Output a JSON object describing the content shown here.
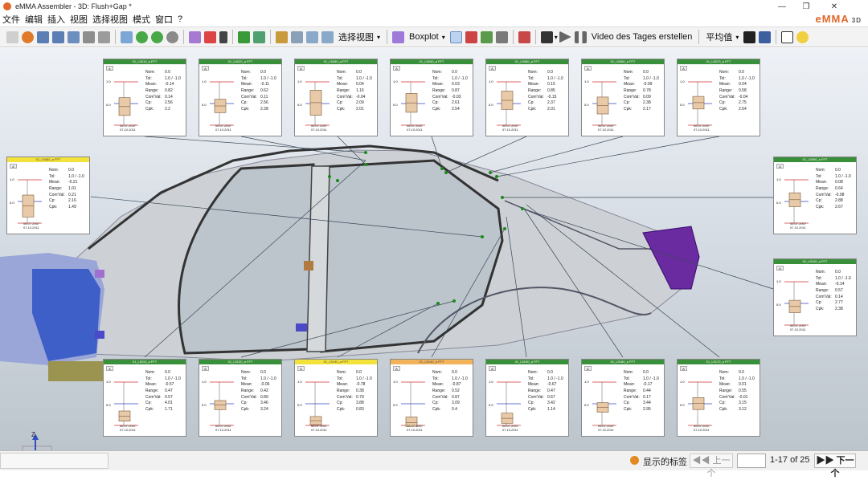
{
  "window": {
    "title": "eMMA Assembler - 3D: Flush+Gap *"
  },
  "menu": [
    "文件",
    "编辑",
    "插入",
    "视图",
    "选择视图",
    "模式",
    "窗口",
    "?"
  ],
  "brand": {
    "name": "eMMA",
    "suffix": "3D",
    "color": "#e1682a"
  },
  "toolbar": {
    "select_view": "选择视图",
    "boxplot": "Boxplot",
    "video": "Video des Tages erstellen",
    "average": "平均值"
  },
  "panel_labels": {
    "nom": "Nom:",
    "tol": "Tol:",
    "mean": "Mean:",
    "range": "Range:",
    "comval": "Com'Val:",
    "cp": "Cp:",
    "cpk": "Cpk:"
  },
  "panels": [
    {
      "header": "01_L5010_a FFT",
      "button": "A",
      "nom": "0.0",
      "tol": "1.0 / -1.0",
      "mean": "-0.14",
      "range": "0.82",
      "comval": "0.14",
      "cp": "2.56",
      "cpk": "2.2",
      "dates": [
        "06.07.2007",
        "07.10.2011"
      ],
      "style": "green",
      "axis": [
        "1.0",
        "0.0",
        "-1.0"
      ]
    },
    {
      "header": "01_L5020_a FFT",
      "button": "A",
      "nom": "0.0",
      "tol": "1.0 / -1.0",
      "mean": "-0.11",
      "range": "0.62",
      "comval": "0.11",
      "cp": "2.56",
      "cpk": "2.28",
      "dates": [
        "06.07.2007",
        "07.10.2011"
      ],
      "style": "green",
      "axis": [
        "1.0",
        "0.0",
        "-1.0"
      ]
    },
    {
      "header": "01_L5030_a FFT",
      "button": "A",
      "nom": "0.0",
      "tol": "1.0 / -1.0",
      "mean": "0.04",
      "range": "1.16",
      "comval": "-0.04",
      "cp": "2.09",
      "cpk": "2.01",
      "dates": [
        "06.07.2007",
        "07.10.2011"
      ],
      "style": "green",
      "axis": [
        "1.0",
        "0.0",
        "-1.0"
      ]
    },
    {
      "header": "01_L5040_a FFT",
      "button": "A",
      "nom": "0.0",
      "tol": "1.0 / -1.0",
      "mean": "0.03",
      "range": "0.87",
      "comval": "-0.03",
      "cp": "2.61",
      "cpk": "2.54",
      "dates": [
        "06.07.2007",
        "07.10.2011"
      ],
      "style": "green",
      "axis": [
        "1.0",
        "0.0",
        "-1.0"
      ]
    },
    {
      "header": "01_L5050_a FFT",
      "button": "A",
      "nom": "0.0",
      "tol": "1.0 / -1.0",
      "mean": "0.15",
      "range": "0.85",
      "comval": "-0.15",
      "cp": "2.37",
      "cpk": "2.01",
      "dates": [
        "06.07.2007",
        "07.10.2011"
      ],
      "style": "green",
      "axis": [
        "1.0",
        "0.0",
        "-1.0"
      ]
    },
    {
      "header": "01_L5060_a FFT",
      "button": "A",
      "nom": "0.0",
      "tol": "1.0 / -1.0",
      "mean": "-0.09",
      "range": "0.78",
      "comval": "0.09",
      "cp": "2.38",
      "cpk": "2.17",
      "dates": [
        "06.07.2007",
        "07.10.2011"
      ],
      "style": "green",
      "axis": [
        "1.0",
        "0.0",
        "-1.0"
      ]
    },
    {
      "header": "01_L5070_a FFT",
      "button": "A",
      "nom": "0.0",
      "tol": "1.0 / -1.0",
      "mean": "0.04",
      "range": "0.58",
      "comval": "-0.04",
      "cp": "2.75",
      "cpk": "2.64",
      "dates": [
        "06.07.2007",
        "07.10.2011"
      ],
      "style": "green",
      "axis": [
        "1.0",
        "0.0",
        "-1.0"
      ]
    },
    {
      "header": "01_L5080_a FFT",
      "button": "A",
      "nom": "0.0",
      "tol": "1.0 / -1.0",
      "mean": "-0.21",
      "range": "1.01",
      "comval": "0.21",
      "cp": "2.16",
      "cpk": "1.49",
      "dates": [
        "06.07.2007",
        "07.10.2011"
      ],
      "style": "yellow",
      "axis": [
        "1.0",
        "0.0",
        "-1.0"
      ]
    },
    {
      "header": "01_L5090_a FFT",
      "button": "A",
      "nom": "0.0",
      "tol": "1.0 / -1.0",
      "mean": "0.08",
      "range": "0.64",
      "comval": "-0.08",
      "cp": "2.88",
      "cpk": "2.67",
      "dates": [
        "06.07.2007",
        "07.10.2011"
      ],
      "style": "green",
      "axis": [
        "1.0",
        "0.0",
        "-1.0"
      ]
    },
    {
      "header": "01_L5100_a FFT",
      "button": "A",
      "nom": "0.0",
      "tol": "1.0 / -1.0",
      "mean": "-0.14",
      "range": "0.57",
      "comval": "0.14",
      "cp": "2.77",
      "cpk": "2.38",
      "dates": [
        "06.07.2007",
        "07.10.2011"
      ],
      "style": "green",
      "axis": [
        "1.0",
        "0.0",
        "-1.0"
      ]
    },
    {
      "header": "01_L5110_a FFT",
      "button": "A",
      "nom": "0.0",
      "tol": "1.0 / -1.0",
      "mean": "-0.57",
      "range": "0.47",
      "comval": "0.57",
      "cp": "4.01",
      "cpk": "1.71",
      "dates": [
        "06.07.2007",
        "07.10.2011"
      ],
      "style": "green",
      "axis": [
        "1.0",
        "0.0",
        "-1.0"
      ]
    },
    {
      "header": "01_L5120_a FFT",
      "button": "A",
      "nom": "0.0",
      "tol": "1.0 / -1.0",
      "mean": "-0.06",
      "range": "0.42",
      "comval": "0.89",
      "cp": "3.46",
      "cpk": "3.24",
      "dates": [
        "06.07.2007",
        "07.10.2011"
      ],
      "style": "green",
      "axis": [
        "1.0",
        "0.0",
        "-1.0"
      ]
    },
    {
      "header": "01_L5130_a FFT",
      "button": "A",
      "nom": "0.0",
      "tol": "1.0 / -1.0",
      "mean": "-0.78",
      "range": "0.38",
      "comval": "0.79",
      "cp": "3.88",
      "cpk": "0.83",
      "dates": [
        "06.07.2007",
        "07.10.2011"
      ],
      "style": "yellow",
      "axis": [
        "1.0",
        "0.0",
        "-1.0"
      ]
    },
    {
      "header": "01_L5140_a FFT",
      "button": "A",
      "nom": "0.0",
      "tol": "1.0 / -1.0",
      "mean": "-0.87",
      "range": "0.52",
      "comval": "0.87",
      "cp": "3.09",
      "cpk": "0.4",
      "dates": [
        "06.07.2007",
        "07.10.2011"
      ],
      "style": "orange",
      "axis": [
        "1.0",
        "0.0",
        "-1.0"
      ]
    },
    {
      "header": "01_L5150_a FFT",
      "button": "A",
      "nom": "0.0",
      "tol": "1.0 / -1.0",
      "mean": "-0.67",
      "range": "0.47",
      "comval": "0.67",
      "cp": "3.42",
      "cpk": "1.14",
      "dates": [
        "06.07.2007",
        "07.10.2011"
      ],
      "style": "green",
      "axis": [
        "1.0",
        "0.0",
        "-1.0"
      ]
    },
    {
      "header": "01_L5160_a FFT",
      "button": "A",
      "nom": "0.0",
      "tol": "1.0 / -1.0",
      "mean": "-0.17",
      "range": "0.44",
      "comval": "0.17",
      "cp": "3.44",
      "cpk": "2.95",
      "dates": [
        "06.07.2007",
        "07.10.2011"
      ],
      "style": "green",
      "axis": [
        "1.0",
        "0.0",
        "-1.0"
      ]
    },
    {
      "header": "01_L5170_a FFT",
      "button": "A",
      "nom": "0.0",
      "tol": "1.0 / -1.0",
      "mean": "0.01",
      "range": "0.55",
      "comval": "-0.01",
      "cp": "3.15",
      "cpk": "3.12",
      "dates": [
        "06.07.2007",
        "07.10.2011"
      ],
      "style": "green",
      "axis": [
        "1.0",
        "0.0",
        "-1.0"
      ]
    }
  ],
  "axes": {
    "z": "Z",
    "x": "X"
  },
  "status": {
    "label": "显示的标签",
    "prev": "上一个",
    "page_value": "",
    "count": "1-17 of 25",
    "next": "下一个"
  }
}
